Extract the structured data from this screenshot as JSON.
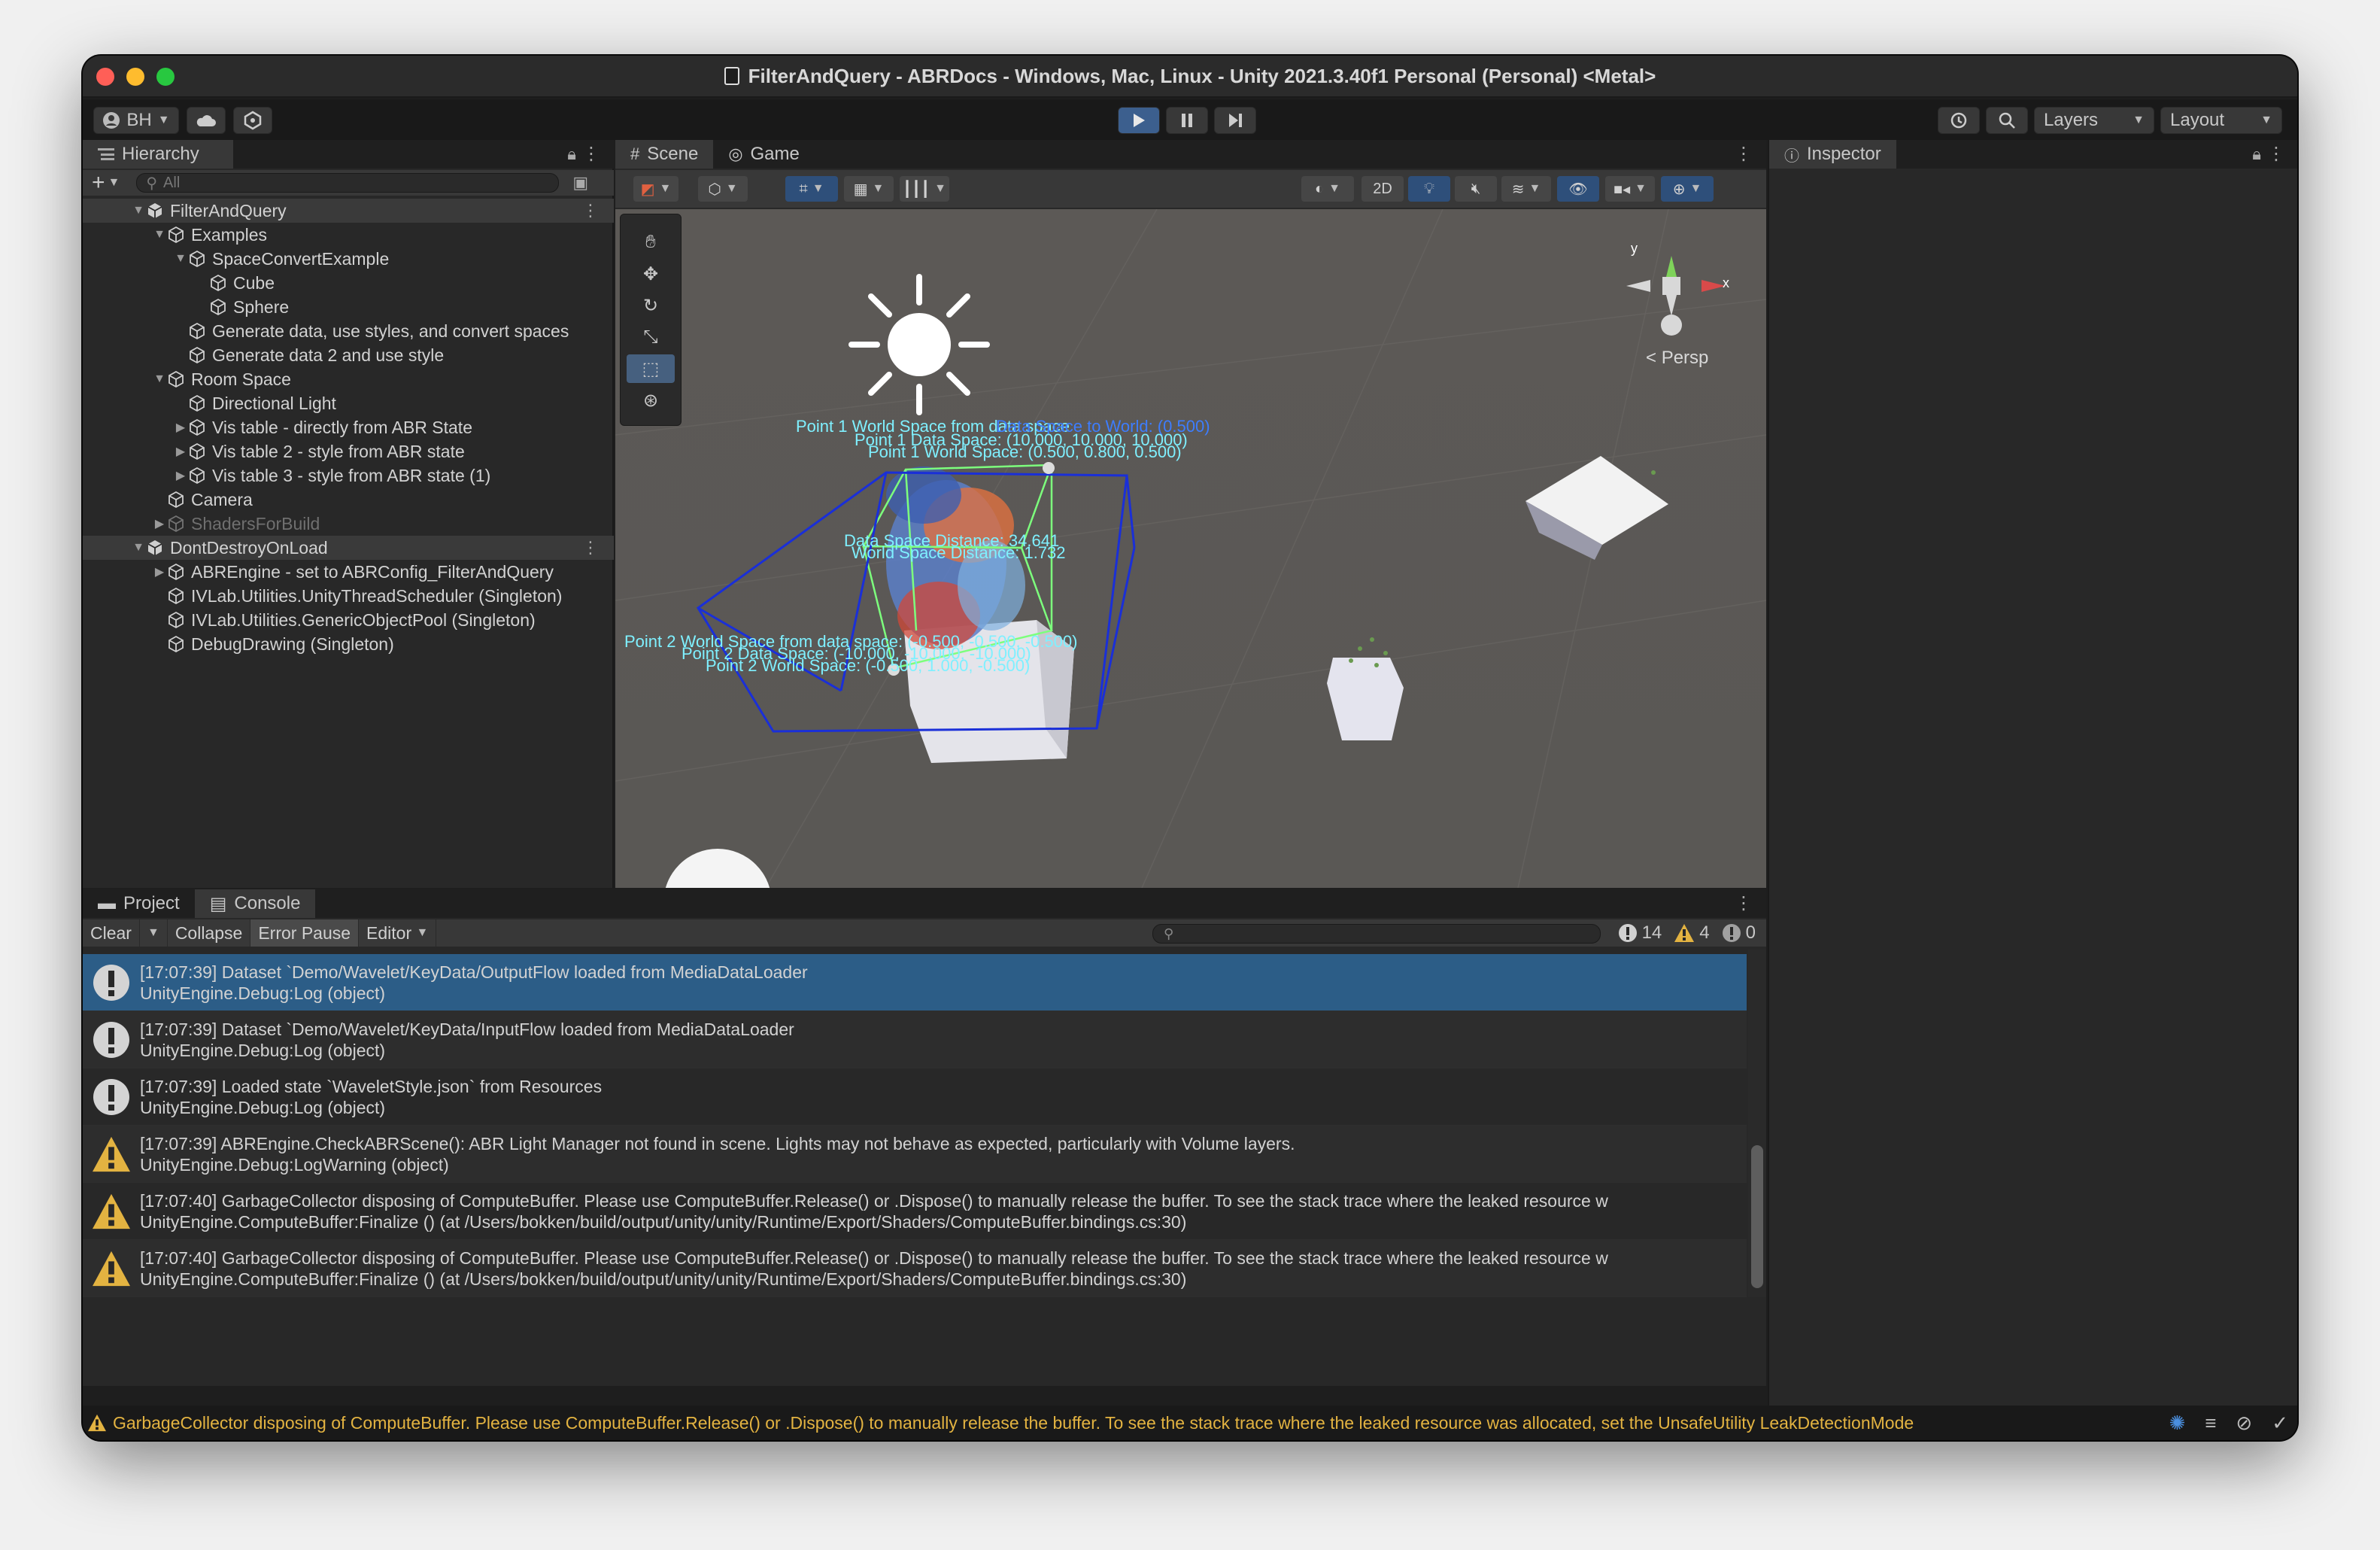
{
  "window": {
    "title": "FilterAndQuery - ABRDocs - Windows, Mac, Linux - Unity 2021.3.40f1 Personal (Personal) <Metal>"
  },
  "toolbar": {
    "account_label": "BH",
    "layers_label": "Layers",
    "layout_label": "Layout"
  },
  "hierarchy": {
    "tab_label": "Hierarchy",
    "search_placeholder": "All",
    "rows": [
      {
        "label": "FilterAndQuery",
        "depth": 0,
        "type": "scene",
        "arrow": "▼"
      },
      {
        "label": "Examples",
        "depth": 1,
        "type": "object",
        "arrow": "▼"
      },
      {
        "label": "SpaceConvertExample",
        "depth": 2,
        "type": "object",
        "arrow": "▼"
      },
      {
        "label": "Cube",
        "depth": 3,
        "type": "object",
        "arrow": ""
      },
      {
        "label": "Sphere",
        "depth": 3,
        "type": "object",
        "arrow": ""
      },
      {
        "label": "Generate data, use styles, and convert spaces",
        "depth": 2,
        "type": "object",
        "arrow": ""
      },
      {
        "label": "Generate data 2 and use style",
        "depth": 2,
        "type": "object",
        "arrow": ""
      },
      {
        "label": "Room Space",
        "depth": 1,
        "type": "object",
        "arrow": "▼"
      },
      {
        "label": "Directional Light",
        "depth": 2,
        "type": "object",
        "arrow": ""
      },
      {
        "label": "Vis table - directly from ABR State",
        "depth": 2,
        "type": "object",
        "arrow": "▶"
      },
      {
        "label": "Vis table 2 - style from ABR state",
        "depth": 2,
        "type": "object",
        "arrow": "▶"
      },
      {
        "label": "Vis table 3 - style from ABR state (1)",
        "depth": 2,
        "type": "object",
        "arrow": "▶"
      },
      {
        "label": "Camera",
        "depth": 1,
        "type": "object",
        "arrow": ""
      },
      {
        "label": "ShadersForBuild",
        "depth": 1,
        "type": "dim",
        "arrow": "▶"
      },
      {
        "label": "DontDestroyOnLoad",
        "depth": 0,
        "type": "scene",
        "arrow": "▼"
      },
      {
        "label": "ABREngine - set to ABRConfig_FilterAndQuery",
        "depth": 1,
        "type": "object",
        "arrow": "▶"
      },
      {
        "label": "IVLab.Utilities.UnityThreadScheduler (Singleton)",
        "depth": 1,
        "type": "object",
        "arrow": ""
      },
      {
        "label": "IVLab.Utilities.GenericObjectPool (Singleton)",
        "depth": 1,
        "type": "object",
        "arrow": ""
      },
      {
        "label": "DebugDrawing (Singleton)",
        "depth": 1,
        "type": "object",
        "arrow": ""
      }
    ]
  },
  "scene": {
    "tab_scene": "Scene",
    "tab_game": "Game",
    "btn_2d": "2D",
    "persp_label": "Persp",
    "gizmo_y": "y",
    "gizmo_x": "x",
    "annotations": {
      "p1_world_from_data": "Point 1 World Space from data space",
      "p1_data_space": "Point 1 Data Space: (10.000, 10.000, 10.000)",
      "p1_world_space": "Point 1 World Space: (0.500, 0.800, 0.500)",
      "data_distance": "Data Space Distance: 34.641",
      "world_distance": "World Space Distance: 1.732",
      "p2_world_from_data": "Point 2 World Space from data space: (-0.500, -0.500, -0.500)",
      "p2_data_space": "Point 2 Data Space: (-10.000, -10.000, -10.000)",
      "p2_world_space": "Point 2 World Space: (-0.500, 1.000, -0.500)",
      "overlap_text": "Data Space to World: (0.500)"
    }
  },
  "inspector": {
    "tab_label": "Inspector"
  },
  "console": {
    "tab_project": "Project",
    "tab_console": "Console",
    "btn_clear": "Clear",
    "btn_collapse": "Collapse",
    "btn_error_pause": "Error Pause",
    "btn_editor": "Editor",
    "count_info": "14",
    "count_warn": "4",
    "count_error": "0",
    "logs": [
      {
        "level": "info",
        "line1": "[17:07:39] Dataset `Demo/Wavelet/KeyData/OutputFlow loaded from MediaDataLoader",
        "line2": "UnityEngine.Debug:Log (object)",
        "selected": true
      },
      {
        "level": "info",
        "line1": "[17:07:39] Dataset `Demo/Wavelet/KeyData/InputFlow loaded from MediaDataLoader",
        "line2": "UnityEngine.Debug:Log (object)",
        "selected": false
      },
      {
        "level": "info",
        "line1": "[17:07:39] Loaded state `WaveletStyle.json` from Resources",
        "line2": "UnityEngine.Debug:Log (object)",
        "selected": false
      },
      {
        "level": "warning",
        "line1": "[17:07:39] ABREngine.CheckABRScene(): ABR Light Manager not found in scene. Lights may not behave as expected, particularly with Volume layers.",
        "line2": "UnityEngine.Debug:LogWarning (object)",
        "selected": false
      },
      {
        "level": "warning",
        "line1": "[17:07:40] GarbageCollector disposing of ComputeBuffer. Please use ComputeBuffer.Release() or .Dispose() to manually release the buffer. To see the stack trace where the leaked resource w",
        "line2": "UnityEngine.ComputeBuffer:Finalize () (at /Users/bokken/build/output/unity/unity/Runtime/Export/Shaders/ComputeBuffer.bindings.cs:30)",
        "selected": false
      },
      {
        "level": "warning",
        "line1": "[17:07:40] GarbageCollector disposing of ComputeBuffer. Please use ComputeBuffer.Release() or .Dispose() to manually release the buffer. To see the stack trace where the leaked resource w",
        "line2": "UnityEngine.ComputeBuffer:Finalize () (at /Users/bokken/build/output/unity/unity/Runtime/Export/Shaders/ComputeBuffer.bindings.cs:30)",
        "selected": false
      }
    ]
  },
  "statusbar": {
    "message": "GarbageCollector disposing of ComputeBuffer. Please use ComputeBuffer.Release() or .Dispose() to manually release the buffer. To see the stack trace where the leaked resource was allocated, set the UnsafeUtility LeakDetectionMode"
  },
  "colors": {
    "accent": "#2c5d87",
    "warning": "#e3b341",
    "annotation_cyan": "#7ff0ff",
    "annotation_blue": "#3d7dff",
    "bounds_green": "#7dff7d",
    "bounds_blue": "#1a2fd8"
  }
}
